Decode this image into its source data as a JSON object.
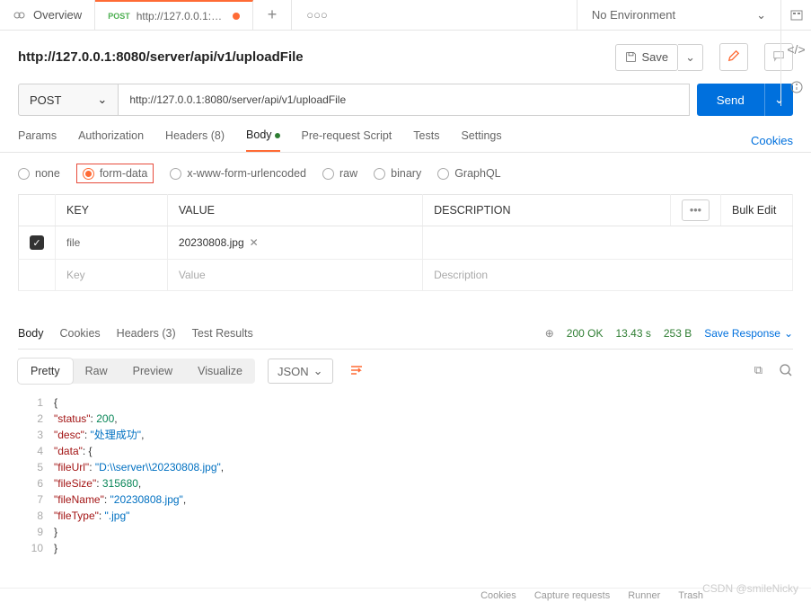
{
  "tabs": {
    "overview": "Overview",
    "active_method": "POST",
    "active_url": "http://127.0.0.1:8080/s"
  },
  "env": {
    "label": "No Environment"
  },
  "request": {
    "title": "http://127.0.0.1:8080/server/api/v1/uploadFile",
    "method": "POST",
    "url": "http://127.0.0.1:8080/server/api/v1/uploadFile",
    "save": "Save",
    "send": "Send"
  },
  "req_tabs": {
    "params": "Params",
    "auth": "Authorization",
    "headers": "Headers (8)",
    "body": "Body",
    "prereq": "Pre-request Script",
    "tests": "Tests",
    "settings": "Settings",
    "cookies": "Cookies"
  },
  "body_types": {
    "none": "none",
    "formdata": "form-data",
    "xwww": "x-www-form-urlencoded",
    "raw": "raw",
    "binary": "binary",
    "graphql": "GraphQL"
  },
  "table": {
    "key_h": "KEY",
    "value_h": "VALUE",
    "desc_h": "DESCRIPTION",
    "bulk": "Bulk Edit",
    "row1_key": "file",
    "row1_value": "20230808.jpg",
    "ph_key": "Key",
    "ph_value": "Value",
    "ph_desc": "Description"
  },
  "resp_tabs": {
    "body": "Body",
    "cookies": "Cookies",
    "headers": "Headers (3)",
    "tests": "Test Results"
  },
  "resp_meta": {
    "status": "200 OK",
    "time": "13.43 s",
    "size": "253 B",
    "save": "Save Response"
  },
  "view_tabs": {
    "pretty": "Pretty",
    "raw": "Raw",
    "preview": "Preview",
    "visualize": "Visualize",
    "format": "JSON"
  },
  "response_body": {
    "status": 200,
    "desc": "处理成功",
    "data": {
      "fileUrl": "D:\\\\server\\\\20230808.jpg",
      "fileSize": 315680,
      "fileName": "20230808.jpg",
      "fileType": ".jpg"
    }
  },
  "watermark": "CSDN @smileNicky",
  "footer": {
    "cookies": "Cookies",
    "capture": "Capture requests",
    "runner": "Runner",
    "trash": "Trash"
  }
}
